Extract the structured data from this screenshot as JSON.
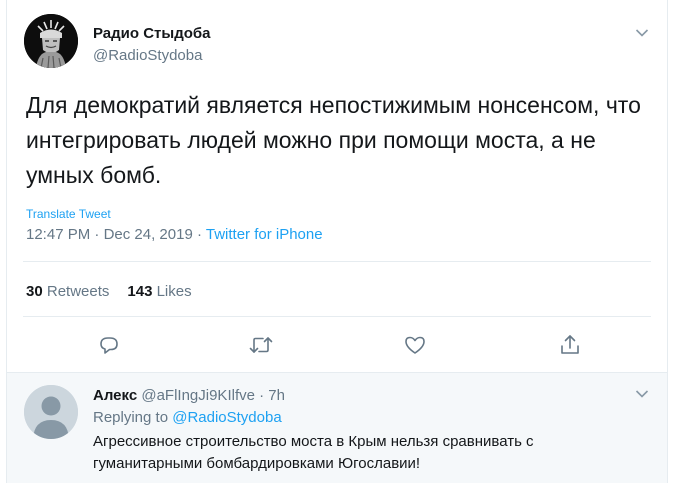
{
  "tweet": {
    "author_name": "Радио Стыдоба",
    "author_handle": "@RadioStydoba",
    "text": "Для демократий является непостижимым нонсенсом, что интегрировать людей можно при помощи моста, а не умных бомб.",
    "translate_label": "Translate Tweet",
    "time": "12:47 PM",
    "separator": " · ",
    "date": "Dec 24, 2019",
    "source": "Twitter for iPhone",
    "retweets_count": "30",
    "retweets_label": "Retweets",
    "likes_count": "143",
    "likes_label": "Likes"
  },
  "reply": {
    "author_name": "Алекс",
    "author_handle": "@aFlIngJi9KIlfve",
    "separator": " · ",
    "time": "7h",
    "replying_prefix": "Replying to",
    "replying_to": "@RadioStydoba",
    "text": "Агрессивное строительство моста в Крым нельзя сравнивать с гуманитарными бомбардировками Югославии!"
  },
  "icons": {
    "reply": "reply-icon",
    "retweet": "retweet-icon",
    "like": "heart-icon",
    "share": "share-icon",
    "more": "chevron-down-icon"
  },
  "colors": {
    "link": "#1da1f2",
    "secondary_text": "#657786",
    "primary_text": "#14171a",
    "reply_background": "#f5f8fa",
    "divider": "#e6ecf0"
  }
}
